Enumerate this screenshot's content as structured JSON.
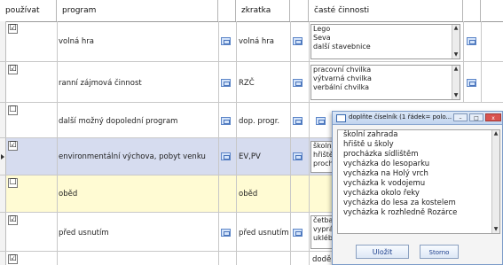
{
  "headers": {
    "pouzivat": "používat",
    "program": "program",
    "zkratka": "zkratka",
    "caste": "časté činnosti"
  },
  "rows": [
    {
      "checked": "☑",
      "program": "volná hra",
      "zkratka": "volná hra",
      "activities": [
        "Lego",
        "Seva",
        "další stavebnice"
      ]
    },
    {
      "checked": "☑",
      "program": "ranní zájmová činnost",
      "zkratka": "RZČ",
      "activities": [
        "pracovní chvilka",
        "výtvarná chvilka",
        "verbální chvilka"
      ]
    },
    {
      "checked": "☐",
      "program": "další možný dopolední program",
      "zkratka": "dop. progr.",
      "activities": []
    },
    {
      "checked": "☑",
      "program": "environmentální výchova, pobyt venku",
      "zkratka": "EV,PV",
      "activities": [
        "školní",
        "hřiště",
        "procha"
      ]
    },
    {
      "checked": "☐",
      "program": "oběd",
      "zkratka": "oběd",
      "activities": []
    },
    {
      "checked": "☑",
      "program": "před usnutím",
      "zkratka": "před usnutím",
      "activities": [
        "četba",
        "vyprá",
        "ukléb"
      ]
    },
    {
      "checked": "☑",
      "program": "",
      "zkratka": "",
      "activities": [
        "doděl"
      ]
    }
  ],
  "popup": {
    "title": "doplňte číselník (1 řádek= polo...",
    "items": [
      "školní zahrada",
      "hřiště u školy",
      "procházka sídlištěm",
      "vycházka do lesoparku",
      "vycházka na Holý vrch",
      "vycházka k vodojemu",
      "vycházka okolo řeky",
      "vycházka do lesa za kostelem",
      "vycházka k rozhledně Rozárce"
    ],
    "ok": "Uložit",
    "cancel": "Storno",
    "btn_min": "–",
    "btn_max": "□",
    "btn_close": "x"
  },
  "colors": {
    "selected_row": "#d6dcef",
    "yellow_row": "#fffbd3",
    "close_button": "#d9534f"
  }
}
